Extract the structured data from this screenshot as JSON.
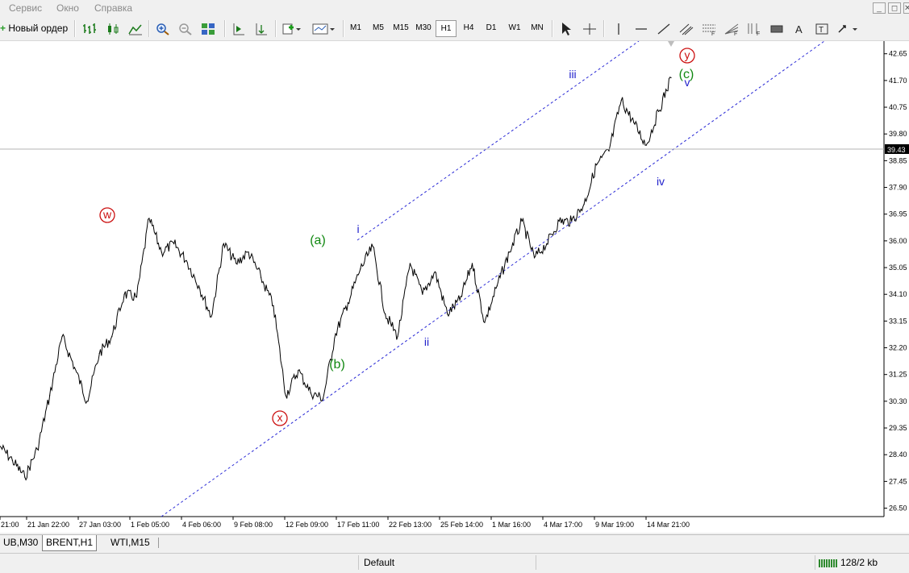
{
  "menu": [
    "Сервис",
    "Окно",
    "Справка"
  ],
  "window_buttons": [
    "_",
    "◻",
    "✕"
  ],
  "toolbar": {
    "new_order": "Новый ордер",
    "timeframes": [
      "M1",
      "M5",
      "M15",
      "M30",
      "H1",
      "H4",
      "D1",
      "W1",
      "MN"
    ],
    "active_timeframe": "H1"
  },
  "chart": {
    "price_labels": [
      "42.65",
      "41.70",
      "40.75",
      "39.80",
      "38.85",
      "37.90",
      "36.95",
      "36.00",
      "35.05",
      "34.10",
      "33.15",
      "32.20",
      "31.25",
      "30.30",
      "29.35",
      "28.40",
      "27.45",
      "26.50"
    ],
    "current_price": "39.43",
    "time_labels": [
      "21:00",
      "21 Jan 22:00",
      "27 Jan 03:00",
      "1 Feb 05:00",
      "4 Feb 06:00",
      "9 Feb 08:00",
      "12 Feb 09:00",
      "17 Feb 11:00",
      "22 Feb 13:00",
      "25 Feb 14:00",
      "1 Mar 16:00",
      "4 Mar 17:00",
      "9 Mar 19:00",
      "14 Mar 21:00"
    ],
    "wave_labels": {
      "w": "w",
      "x": "x",
      "y": "y",
      "a": "(a)",
      "b": "(b)",
      "c": "(c)",
      "i": "i",
      "ii": "ii",
      "iii": "iii",
      "iv": "iv",
      "v": "v"
    },
    "colors": {
      "red": "#cc1111",
      "green": "#118811",
      "blue": "#2222cc",
      "channel": "#2b2bd6"
    }
  },
  "chart_data": {
    "type": "line",
    "title": "",
    "symbol_timeframe": "BRENT,H1",
    "ylim": [
      26.2,
      43.1
    ],
    "x": [
      "21 Jan",
      "21 Jan 22:00",
      "22 Jan",
      "23 Jan",
      "24 Jan",
      "25 Jan",
      "26 Jan",
      "27 Jan 03:00",
      "28 Jan",
      "29 Jan",
      "30 Jan",
      "31 Jan",
      "1 Feb 05:00",
      "2 Feb",
      "3 Feb",
      "4 Feb 06:00",
      "5 Feb",
      "6 Feb",
      "7 Feb",
      "8 Feb",
      "9 Feb 08:00",
      "10 Feb",
      "11 Feb",
      "12 Feb 09:00",
      "13 Feb",
      "14 Feb",
      "15 Feb",
      "16 Feb",
      "17 Feb 11:00",
      "18 Feb",
      "19 Feb",
      "20 Feb",
      "21 Feb",
      "22 Feb 13:00",
      "23 Feb",
      "24 Feb",
      "25 Feb 14:00",
      "26 Feb",
      "27 Feb",
      "28 Feb",
      "1 Mar 16:00",
      "2 Mar",
      "3 Mar",
      "4 Mar 17:00",
      "5 Mar",
      "6 Mar",
      "7 Mar",
      "8 Mar",
      "9 Mar 19:00",
      "10 Mar",
      "11 Mar",
      "12 Mar",
      "13 Mar",
      "14 Mar 21:00",
      "15 Mar"
    ],
    "values": [
      28.7,
      28.2,
      27.6,
      28.6,
      30.5,
      32.6,
      31.5,
      30.3,
      32.0,
      32.6,
      34.1,
      34.0,
      36.8,
      35.6,
      35.9,
      35.3,
      34.4,
      33.3,
      35.9,
      35.2,
      35.6,
      34.7,
      33.7,
      30.5,
      31.4,
      30.6,
      30.4,
      32.7,
      33.8,
      35.0,
      35.8,
      33.4,
      32.6,
      35.2,
      34.1,
      34.9,
      33.4,
      33.9,
      35.2,
      33.1,
      34.4,
      35.6,
      36.7,
      35.4,
      35.9,
      36.7,
      36.7,
      37.3,
      38.7,
      39.2,
      41.0,
      40.2,
      39.4,
      40.6,
      41.8
    ]
  },
  "tabs": [
    "UB,M30",
    "BRENT,H1",
    "WTI,M15"
  ],
  "active_tab": "BRENT,H1",
  "status": {
    "profile": "Default",
    "traffic": "128/2 kb"
  }
}
